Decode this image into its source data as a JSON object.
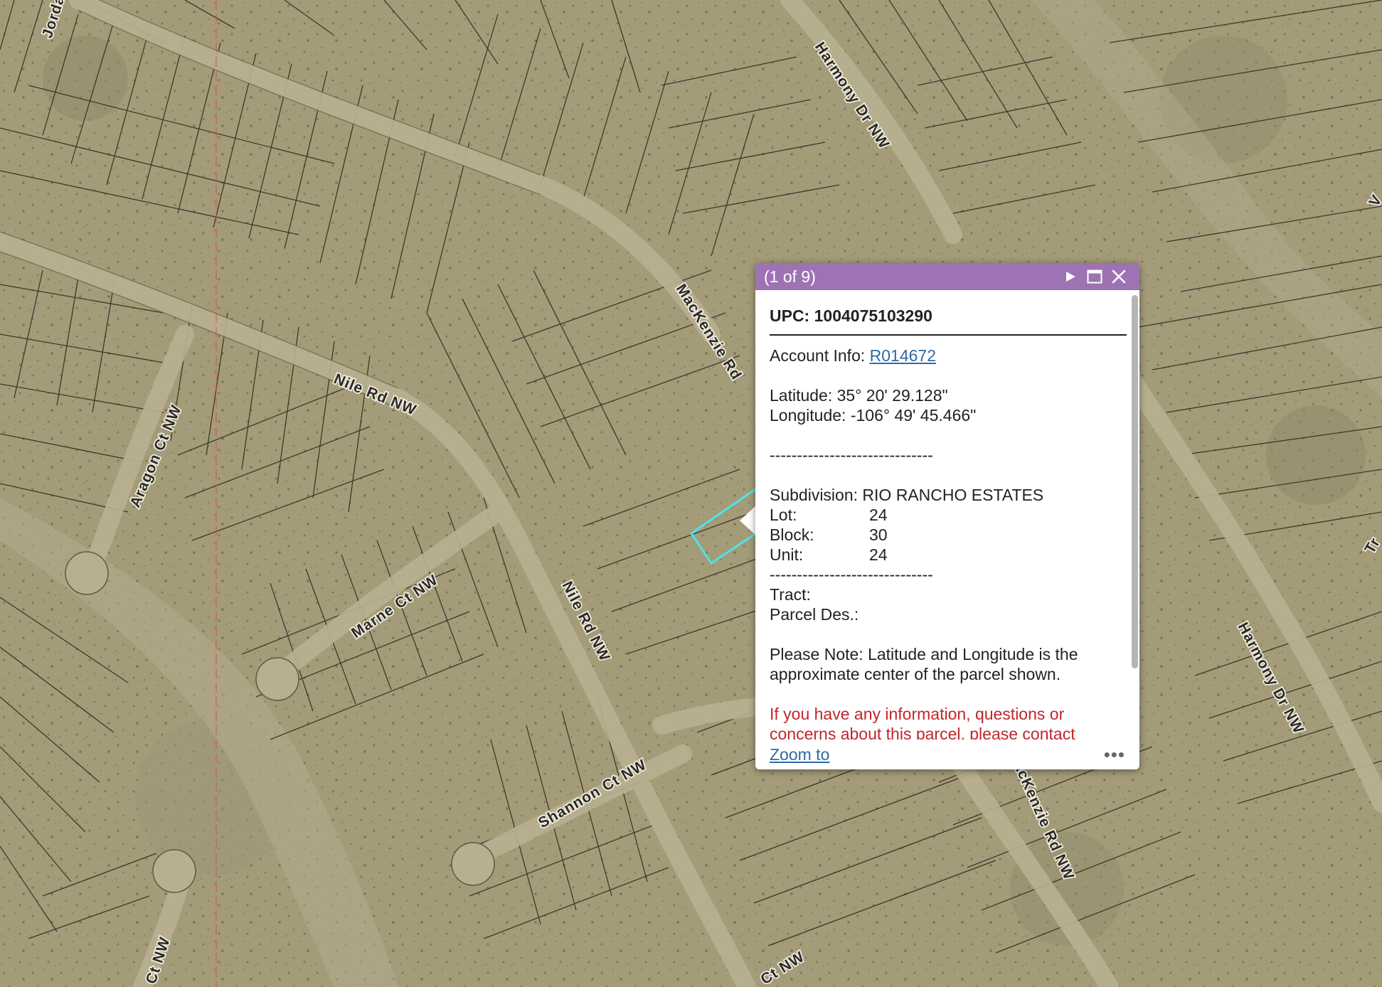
{
  "colors": {
    "header": "#9d73b3",
    "link": "#2f6aa4",
    "warning": "#c0272d",
    "parcel_highlight": "#4fe3e8"
  },
  "map": {
    "road_labels": [
      "Harmony Dr NW",
      "MacKenzie Rd",
      "Nile Rd NW",
      "Nile Rd NW",
      "Aragon Ct NW",
      "Marne Ct NW",
      "Shannon Ct NW",
      "acKenzie Rd NW",
      "Harmony Dr NW",
      "Jorda",
      "Ct NW",
      "Ct NW",
      "Tr",
      "V"
    ]
  },
  "popup": {
    "title": "(1 of 9)",
    "icons": {
      "next": "play-icon",
      "maximize": "maximize-icon",
      "close": "close-icon",
      "more": "more-icon"
    },
    "upc": "UPC: 1004075103290",
    "account_label": "Account Info: ",
    "account_value": "R014672",
    "latitude": "Latitude: 35° 20' 29.128\"",
    "longitude": "Longitude: -106° 49' 45.466\"",
    "separator": "------------------------------",
    "subdivision": "Subdivision: RIO RANCHO ESTATES",
    "lot_label": "Lot:",
    "lot_value": "24",
    "block_label": "Block:",
    "block_value": "30",
    "unit_label": "Unit:",
    "unit_value": "24",
    "tract": "Tract:",
    "parcel_des": "Parcel Des.:",
    "note": "Please Note: Latitude and Longitude is the approximate center of the parcel shown.",
    "contact_note": "If you have any information, questions or concerns about this parcel, please contact",
    "zoom_to": "Zoom to"
  }
}
